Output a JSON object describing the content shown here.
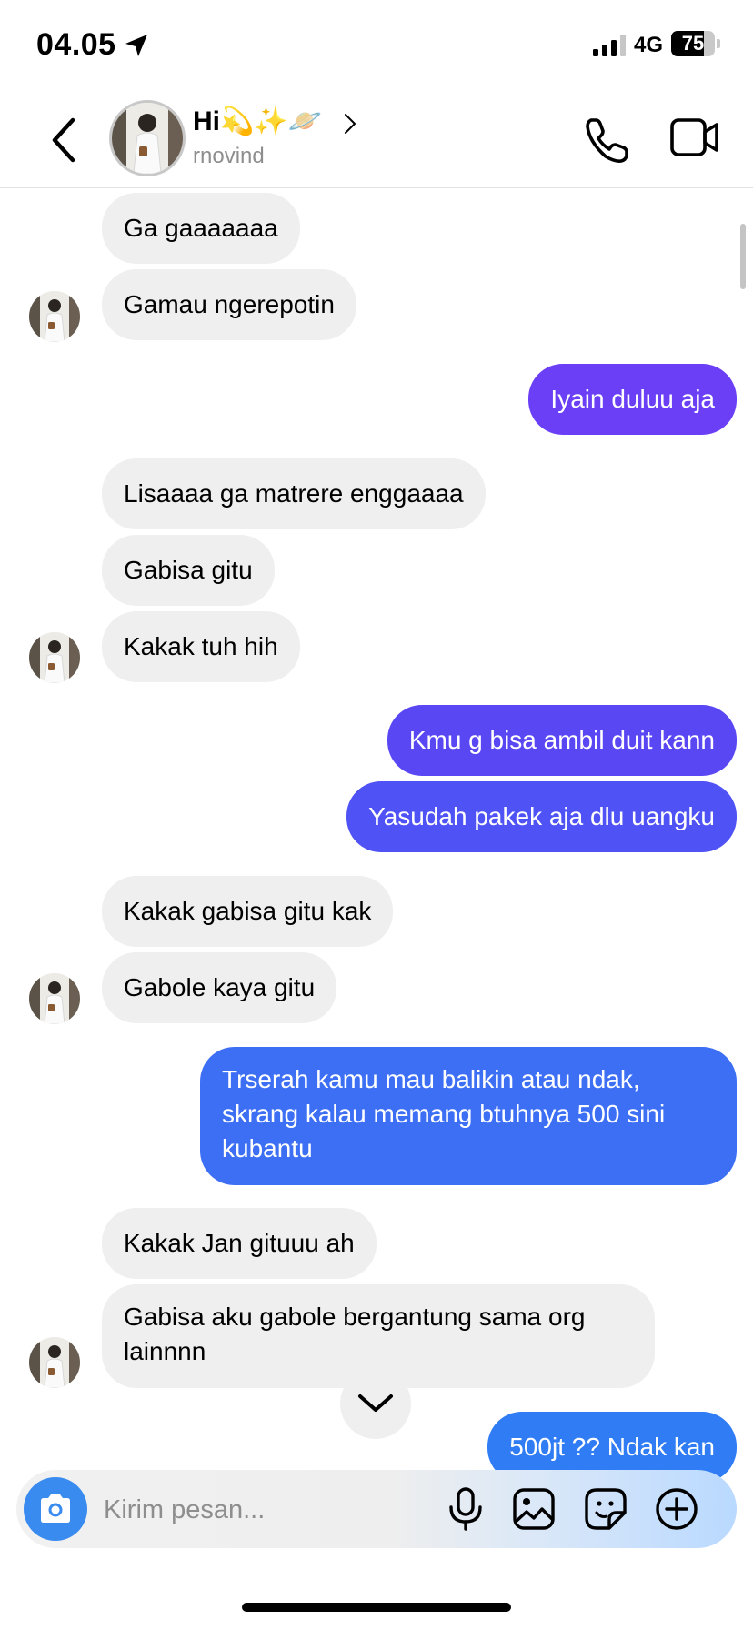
{
  "status_bar": {
    "time": "04.05",
    "network": "4G",
    "battery": "75",
    "battery_level": 0.75
  },
  "header": {
    "title": "Hi💫✨🪐",
    "username": "rnovind"
  },
  "messages": [
    {
      "side": "in",
      "text": "Ga gaaaaaaa"
    },
    {
      "side": "in",
      "text": "Gamau ngerepotin"
    },
    {
      "side": "out",
      "text": "Iyain duluu aja"
    },
    {
      "side": "in",
      "text": "Lisaaaa ga matrere enggaaaa"
    },
    {
      "side": "in",
      "text": "Gabisa gitu"
    },
    {
      "side": "in",
      "text": "Kakak tuh hih"
    },
    {
      "side": "out",
      "text": "Kmu g bisa ambil duit kann"
    },
    {
      "side": "out",
      "text": "Yasudah pakek aja dlu uangku"
    },
    {
      "side": "in",
      "text": "Kakak gabisa gitu kak"
    },
    {
      "side": "in",
      "text": "Gabole kaya gitu"
    },
    {
      "side": "out",
      "text": "Trserah kamu mau balikin atau ndak, skrang kalau memang btuhnya 500 sini kubantu"
    },
    {
      "side": "in",
      "text": "Kakak Jan gituuu ah"
    },
    {
      "side": "in",
      "text": "Gabisa aku gabole bergantung sama org lainnnn"
    },
    {
      "side": "out",
      "text": "500jt ?? Ndak kan"
    }
  ],
  "composer": {
    "placeholder": "Kirim pesan..."
  },
  "colors": {
    "incoming_bubble": "#efefef",
    "outgoing_purple": "#6a3ff5",
    "outgoing_blue": "#3d6ff5",
    "camera_button": "#3a8bf0"
  }
}
